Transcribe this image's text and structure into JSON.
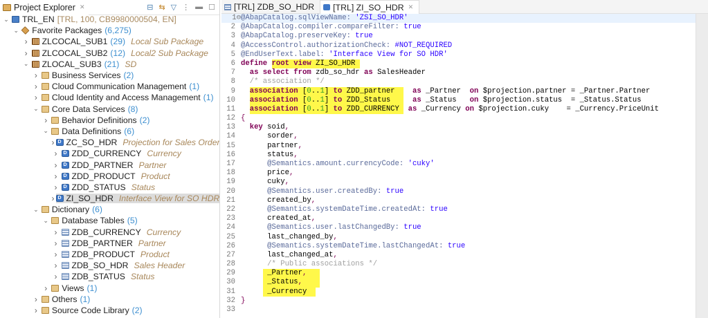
{
  "explorer": {
    "title": "Project Explorer",
    "tree": [
      {
        "lvl": 0,
        "tw": "down",
        "icon": "sys",
        "name": "TRL_EN",
        "sys": "[TRL, 100, CB9980000504, EN]"
      },
      {
        "lvl": 1,
        "tw": "down",
        "icon": "fav",
        "name": "Favorite Packages",
        "count": "(6,275)"
      },
      {
        "lvl": 2,
        "tw": "right",
        "icon": "pkg",
        "name": "ZLCOCAL_SUB1",
        "count": "(29)",
        "desc": "Local Sub Package"
      },
      {
        "lvl": 2,
        "tw": "right",
        "icon": "pkg",
        "name": "ZLCOCAL_SUB2",
        "count": "(12)",
        "desc": "Local2 Sub Package"
      },
      {
        "lvl": 2,
        "tw": "down",
        "icon": "pkg",
        "name": "ZLOCAL_SUB3",
        "count": "(21)",
        "desc": "SD"
      },
      {
        "lvl": 3,
        "tw": "right",
        "icon": "fld",
        "name": "Business Services",
        "count": "(2)"
      },
      {
        "lvl": 3,
        "tw": "right",
        "icon": "fld",
        "name": "Cloud Communication Management",
        "count": "(1)"
      },
      {
        "lvl": 3,
        "tw": "right",
        "icon": "fld",
        "name": "Cloud Identity and Access Management",
        "count": "(1)"
      },
      {
        "lvl": 3,
        "tw": "down",
        "icon": "fld",
        "name": "Core Data Services",
        "count": "(8)"
      },
      {
        "lvl": 4,
        "tw": "right",
        "icon": "fld",
        "name": "Behavior Definitions",
        "count": "(2)"
      },
      {
        "lvl": 4,
        "tw": "down",
        "icon": "fld",
        "name": "Data Definitions",
        "count": "(6)"
      },
      {
        "lvl": 5,
        "tw": "right",
        "icon": "dd",
        "name": "ZC_SO_HDR",
        "desc": "Projection for Sales Order"
      },
      {
        "lvl": 5,
        "tw": "right",
        "icon": "dd",
        "name": "ZDD_CURRENCY",
        "desc": "Currency"
      },
      {
        "lvl": 5,
        "tw": "right",
        "icon": "dd",
        "name": "ZDD_PARTNER",
        "desc": "Partner"
      },
      {
        "lvl": 5,
        "tw": "right",
        "icon": "dd",
        "name": "ZDD_PRODUCT",
        "desc": "Product"
      },
      {
        "lvl": 5,
        "tw": "right",
        "icon": "dd",
        "name": "ZDD_STATUS",
        "desc": "Status"
      },
      {
        "lvl": 5,
        "tw": "right",
        "icon": "dd",
        "name": "ZI_SO_HDR",
        "desc": "Interface View for SO HDR",
        "selected": true
      },
      {
        "lvl": 3,
        "tw": "down",
        "icon": "fld",
        "name": "Dictionary",
        "count": "(6)"
      },
      {
        "lvl": 4,
        "tw": "down",
        "icon": "fld",
        "name": "Database Tables",
        "count": "(5)"
      },
      {
        "lvl": 5,
        "tw": "right",
        "icon": "tbl",
        "name": "ZDB_CURRENCY",
        "desc": "Currency"
      },
      {
        "lvl": 5,
        "tw": "right",
        "icon": "tbl",
        "name": "ZDB_PARTNER",
        "desc": "Partner"
      },
      {
        "lvl": 5,
        "tw": "right",
        "icon": "tbl",
        "name": "ZDB_PRODUCT",
        "desc": "Product"
      },
      {
        "lvl": 5,
        "tw": "right",
        "icon": "tbl",
        "name": "ZDB_SO_HDR",
        "desc": "Sales Header"
      },
      {
        "lvl": 5,
        "tw": "right",
        "icon": "tbl",
        "name": "ZDB_STATUS",
        "desc": "Status"
      },
      {
        "lvl": 4,
        "tw": "right",
        "icon": "fld",
        "name": "Views",
        "count": "(1)"
      },
      {
        "lvl": 3,
        "tw": "right",
        "icon": "fld",
        "name": "Others",
        "count": "(1)"
      },
      {
        "lvl": 3,
        "tw": "right",
        "icon": "fld",
        "name": "Source Code Library",
        "count": "(2)"
      }
    ]
  },
  "tabs": [
    {
      "label": "[TRL] ZDB_SO_HDR",
      "icon": "tbl"
    },
    {
      "label": "[TRL] ZI_SO_HDR",
      "icon": "dd",
      "active": true
    }
  ],
  "code": [
    [
      [
        "a",
        "@AbapCatalog.sqlViewName: "
      ],
      [
        "s",
        "'ZSI_SO_HDR'"
      ]
    ],
    [
      [
        "a",
        "@AbapCatalog.compiler.compareFilter: "
      ],
      [
        "s",
        "true"
      ]
    ],
    [
      [
        "a",
        "@AbapCatalog.preserveKey: "
      ],
      [
        "s",
        "true"
      ]
    ],
    [
      [
        "a",
        "@AccessControl.authorizationCheck: "
      ],
      [
        "s",
        "#NOT_REQUIRED"
      ]
    ],
    [
      [
        "a",
        "@EndUserText.label: "
      ],
      [
        "s",
        "'Interface View for SO HDR'"
      ]
    ],
    [
      [
        "k",
        "define "
      ],
      [
        "k",
        "root view ",
        1
      ],
      [
        "p",
        "ZI_SO_HDR ",
        1
      ]
    ],
    [
      [
        "p",
        "  "
      ],
      [
        "k",
        "as select from "
      ],
      [
        "p",
        "zdb_so_hdr "
      ],
      [
        "k",
        "as "
      ],
      [
        "p",
        "SalesHeader"
      ]
    ],
    [
      [
        "c",
        "  /* association */"
      ]
    ],
    [
      [
        "p",
        "  "
      ],
      [
        "k",
        "association ",
        1
      ],
      [
        "p",
        "[",
        1
      ],
      [
        "n",
        "0",
        1
      ],
      [
        "p",
        "..",
        1
      ],
      [
        "n",
        "1",
        1
      ],
      [
        "p",
        "] ",
        1
      ],
      [
        "k",
        "to ",
        1
      ],
      [
        "p",
        "ZDD_partner  ",
        1
      ],
      [
        "p",
        "  "
      ],
      [
        "k",
        "as "
      ],
      [
        "p",
        "_Partner  "
      ],
      [
        "k",
        "on "
      ],
      [
        "p",
        "$projection.partner = _Partner.Partner"
      ]
    ],
    [
      [
        "p",
        "  "
      ],
      [
        "k",
        "association ",
        1
      ],
      [
        "p",
        "[",
        1
      ],
      [
        "n",
        "0",
        1
      ],
      [
        "p",
        "..",
        1
      ],
      [
        "n",
        "1",
        1
      ],
      [
        "p",
        "] ",
        1
      ],
      [
        "k",
        "to ",
        1
      ],
      [
        "p",
        "ZDD_Status   ",
        1
      ],
      [
        "p",
        "  "
      ],
      [
        "k",
        "as "
      ],
      [
        "p",
        "_Status   "
      ],
      [
        "k",
        "on "
      ],
      [
        "p",
        "$projection.status  = _Status.Status"
      ]
    ],
    [
      [
        "p",
        "  "
      ],
      [
        "k",
        "association ",
        1
      ],
      [
        "p",
        "[",
        1
      ],
      [
        "n",
        "0",
        1
      ],
      [
        "p",
        "..",
        1
      ],
      [
        "n",
        "1",
        1
      ],
      [
        "p",
        "] ",
        1
      ],
      [
        "k",
        "to ",
        1
      ],
      [
        "p",
        "ZDD_CURRENCY ",
        1
      ],
      [
        "p",
        " "
      ],
      [
        "k",
        "as "
      ],
      [
        "p",
        "_Currency "
      ],
      [
        "k",
        "on "
      ],
      [
        "p",
        "$projection.cuky    = _Currency.PriceUnit"
      ]
    ],
    [
      [
        "o",
        "{"
      ]
    ],
    [
      [
        "p",
        "  "
      ],
      [
        "k",
        "key "
      ],
      [
        "p",
        "soid"
      ],
      [
        "o",
        ","
      ]
    ],
    [
      [
        "p",
        "      sorder"
      ],
      [
        "o",
        ","
      ]
    ],
    [
      [
        "p",
        "      partner"
      ],
      [
        "o",
        ","
      ]
    ],
    [
      [
        "p",
        "      status"
      ],
      [
        "o",
        ","
      ]
    ],
    [
      [
        "p",
        "      "
      ],
      [
        "a",
        "@Semantics.amount.currencyCode: "
      ],
      [
        "s",
        "'cuky'"
      ]
    ],
    [
      [
        "p",
        "      price"
      ],
      [
        "o",
        ","
      ]
    ],
    [
      [
        "p",
        "      cuky"
      ],
      [
        "o",
        ","
      ]
    ],
    [
      [
        "p",
        "      "
      ],
      [
        "a",
        "@Semantics.user.createdBy: "
      ],
      [
        "s",
        "true"
      ]
    ],
    [
      [
        "p",
        "      created_by"
      ],
      [
        "o",
        ","
      ]
    ],
    [
      [
        "p",
        "      "
      ],
      [
        "a",
        "@Semantics.systemDateTime.createdAt: "
      ],
      [
        "s",
        "true"
      ]
    ],
    [
      [
        "p",
        "      created_at"
      ],
      [
        "o",
        ","
      ]
    ],
    [
      [
        "p",
        "      "
      ],
      [
        "a",
        "@Semantics.user.lastChangedBy: "
      ],
      [
        "s",
        "true"
      ]
    ],
    [
      [
        "p",
        "      last_changed_by"
      ],
      [
        "o",
        ","
      ]
    ],
    [
      [
        "p",
        "      "
      ],
      [
        "a",
        "@Semantics.systemDateTime.lastChangedAt: "
      ],
      [
        "s",
        "true"
      ]
    ],
    [
      [
        "p",
        "      last_changed_at"
      ],
      [
        "o",
        ","
      ]
    ],
    [
      [
        "c",
        "      /* Public associations */"
      ]
    ],
    [
      [
        "p",
        "     "
      ],
      [
        "p",
        " _Partner",
        1
      ],
      [
        "o",
        ",",
        1
      ],
      [
        "p",
        "   ",
        1
      ]
    ],
    [
      [
        "p",
        "     "
      ],
      [
        "p",
        " _Status",
        1
      ],
      [
        "o",
        ",",
        1
      ],
      [
        "p",
        "    ",
        1
      ]
    ],
    [
      [
        "p",
        "     "
      ],
      [
        "p",
        " _Currency  ",
        1
      ]
    ],
    [
      [
        "o",
        "}"
      ]
    ],
    [
      [
        "p",
        ""
      ]
    ]
  ]
}
